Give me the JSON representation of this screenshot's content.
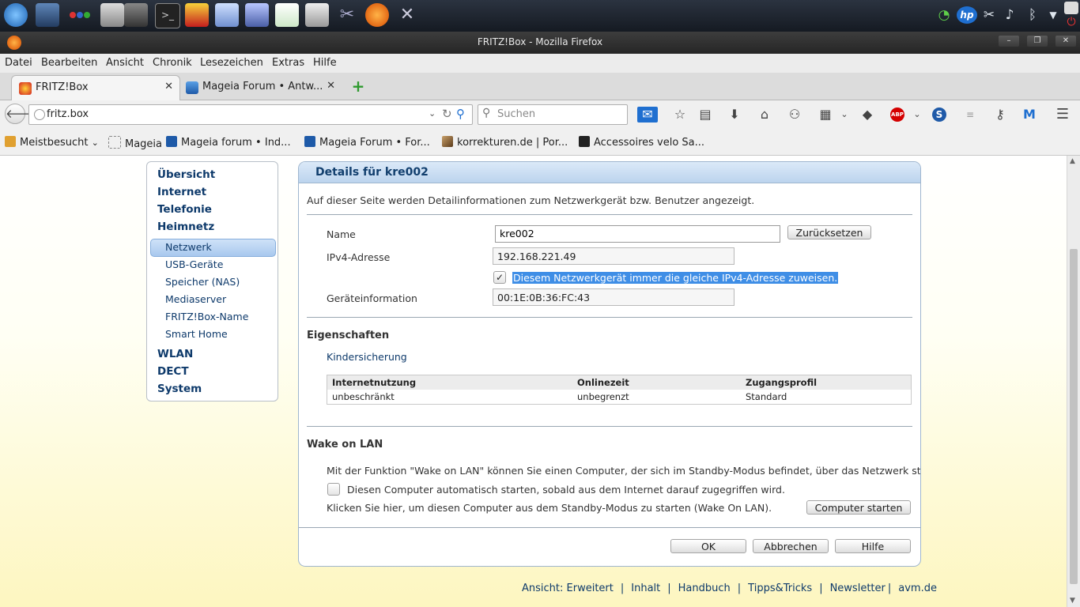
{
  "window": {
    "title": "FRITZ!Box - Mozilla Firefox"
  },
  "menubar": {
    "items": [
      "Datei",
      "Bearbeiten",
      "Ansicht",
      "Chronik",
      "Lesezeichen",
      "Extras",
      "Hilfe"
    ]
  },
  "tabs": [
    {
      "label": "FRITZ!Box",
      "active": true
    },
    {
      "label": "Mageia Forum • Antw...",
      "active": false
    }
  ],
  "navbar": {
    "url": "fritz.box",
    "search_placeholder": "Suchen"
  },
  "bookmarks": [
    "Meistbesucht",
    "Mageia",
    "Mageia forum • Ind...",
    "Mageia Forum • For...",
    "korrekturen.de | Por...",
    "Accessoires velo Sa..."
  ],
  "sidenav": {
    "top": [
      "Übersicht",
      "Internet",
      "Telefonie",
      "Heimnetz"
    ],
    "sub": [
      "Netzwerk",
      "USB-Geräte",
      "Speicher (NAS)",
      "Mediaserver",
      "FRITZ!Box-Name",
      "Smart Home"
    ],
    "bottom": [
      "WLAN",
      "DECT",
      "System"
    ],
    "active": "Netzwerk"
  },
  "panel": {
    "title": "Details für kre002",
    "intro": "Auf dieser Seite werden Detailinformationen zum Netzwerkgerät bzw. Benutzer angezeigt.",
    "name_label": "Name",
    "name_value": "kre002",
    "reset_button": "Zurücksetzen",
    "ipv4_label": "IPv4-Adresse",
    "ipv4_value": "192.168.221.49",
    "same_ip_checkbox": "Diesem Netzwerkgerät immer die gleiche IPv4-Adresse zuweisen.",
    "same_ip_checked": true,
    "device_label": "Geräteinformation",
    "device_value": "00:1E:0B:36:FC:43",
    "properties_title": "Eigenschaften",
    "parental_link": "Kindersicherung",
    "table": {
      "headers": [
        "Internetnutzung",
        "Onlinezeit",
        "Zugangsprofil"
      ],
      "rows": [
        [
          "unbeschränkt",
          "unbegrenzt",
          "Standard"
        ]
      ]
    },
    "wol_title": "Wake on LAN",
    "wol_desc": "Mit der Funktion \"Wake on LAN\" können Sie einen Computer, der sich im Standby-Modus befindet, über das Netzwerk starten.",
    "wol_checkbox": "Diesen Computer automatisch starten, sobald aus dem Internet darauf zugegriffen wird.",
    "wol_checked": false,
    "wol_start_text": "Klicken Sie hier, um diesen Computer aus dem Standby-Modus zu starten (Wake On LAN).",
    "wol_button": "Computer starten",
    "ok_button": "OK",
    "cancel_button": "Abbrechen",
    "help_button": "Hilfe"
  },
  "footer": {
    "view_label": "Ansicht:",
    "view_value": "Erweitert",
    "links": [
      "Inhalt",
      "Handbuch",
      "Tipps&Tricks",
      "Newsletter",
      "avm.de"
    ]
  },
  "colors": {
    "accent": "#0e3a6b",
    "selection": "#3f8ee6",
    "panel_header": "#bcd4ee"
  }
}
